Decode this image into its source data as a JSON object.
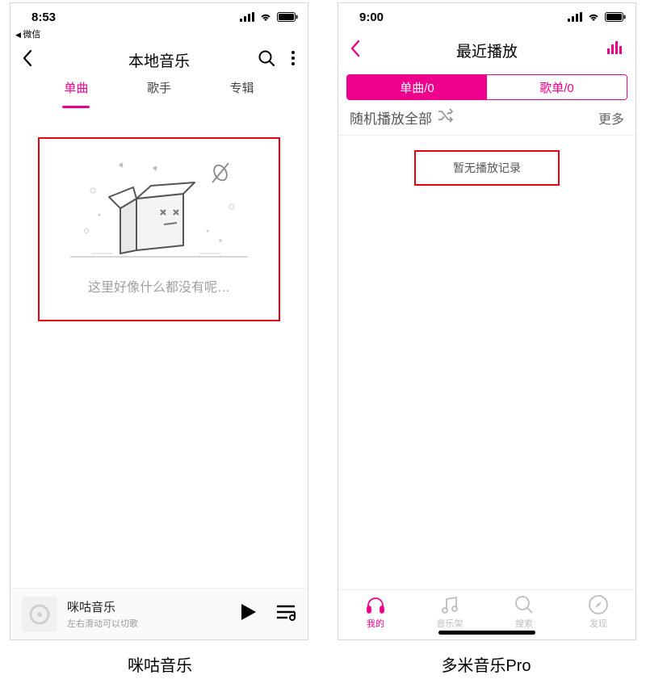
{
  "captions": {
    "left": "咪咕音乐",
    "right": "多米音乐Pro"
  },
  "migu": {
    "status": {
      "time": "8:53",
      "back_app": "微信"
    },
    "nav": {
      "title": "本地音乐"
    },
    "tabs": [
      "单曲",
      "歌手",
      "专辑"
    ],
    "empty_text": "这里好像什么都没有呢…",
    "player": {
      "title": "咪咕音乐",
      "sub": "左右滑动可以切歌"
    }
  },
  "duomi": {
    "status": {
      "time": "9:00"
    },
    "nav": {
      "title": "最近播放"
    },
    "seg": [
      {
        "label": "单曲/0",
        "active": true
      },
      {
        "label": "歌单/0",
        "active": false
      }
    ],
    "shuffle_label": "随机播放全部",
    "more_label": "更多",
    "empty_text": "暂无播放记录",
    "tabbar": [
      {
        "label": "我的",
        "active": true
      },
      {
        "label": "音乐架",
        "active": false
      },
      {
        "label": "搜索",
        "active": false
      },
      {
        "label": "发现",
        "active": false
      }
    ]
  }
}
